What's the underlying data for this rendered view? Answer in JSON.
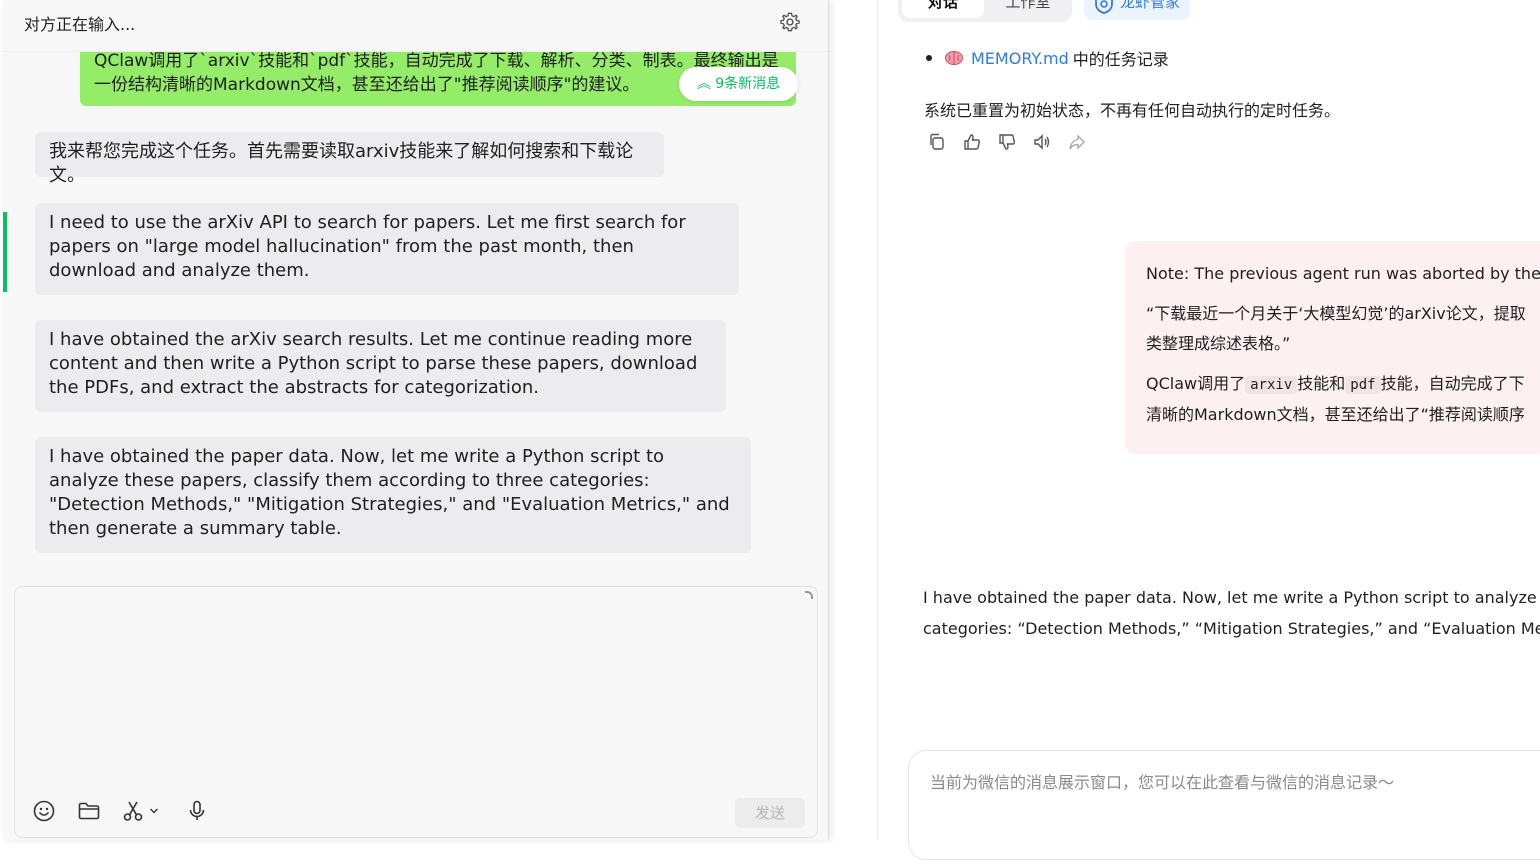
{
  "background": {
    "tabs": [
      {
        "label": "对话",
        "active": true
      },
      {
        "label": "工作室",
        "active": false
      }
    ],
    "guard_label": "龙虾管家",
    "memory_link": "MEMORY.md",
    "memory_suffix": "中的任务记录",
    "reset_text": "系统已重置为初始状态，不再有任何自动执行的定时任务。",
    "user_note": {
      "line1": "Note: The previous agent run was aborted by the us",
      "line2a": "“下载最近一个月关于‘大模型幻觉’的arXiv论文，提取",
      "line2b": "类整理成综述表格。”",
      "line3_prefix": "QClaw调用了",
      "code1": "arxiv",
      "line3_mid": "技能和",
      "code2": "pdf",
      "line3_suffix": "技能，自动完成了下",
      "line4": "清晰的Markdown文档，甚至还给出了“推荐阅读顺序"
    },
    "assistant_para_line1": "I have obtained the paper data. Now, let me write a Python script to analyze these",
    "assistant_para_line2": "categories: “Detection Methods,” “Mitigation Strategies,” and “Evaluation Metrics",
    "input_placeholder": "当前为微信的消息展示窗口，您可以在此查看与微信的消息记录～",
    "link_color": "#2f7ae5"
  },
  "chat": {
    "title": "对方正在输入...",
    "new_messages": "9条新消息",
    "accent_color": "#07c160",
    "messages": [
      {
        "side": "right",
        "text": "QClaw调用了`arxiv`技能和`pdf`技能，自动完成了下载、解析、分类、制表。最终输出是一份结构清晰的Markdown文档，甚至还给出了\"推荐阅读顺序\"的建议。"
      },
      {
        "side": "left",
        "text": "我来帮您完成这个任务。首先需要读取arxiv技能来了解如何搜索和下载论文。"
      },
      {
        "side": "left",
        "text": "I need to use the arXiv API to search for papers. Let me first search for papers on \"large model hallucination\" from the past month, then download and analyze them."
      },
      {
        "side": "left",
        "text": "I have obtained the arXiv search results. Let me continue reading more content and then write a Python script to parse these papers, download the PDFs, and extract the abstracts for categorization."
      },
      {
        "side": "left",
        "text": "I have obtained the paper data. Now, let me write a Python script to analyze these papers, classify them according to three categories: \"Detection Methods,\" \"Mitigation Strategies,\" and \"Evaluation Metrics,\" and then generate a summary table."
      }
    ],
    "composer": {
      "value": "",
      "send_label": "发送",
      "tools": [
        "emoji-icon",
        "folder-icon",
        "scissors-icon",
        "microphone-icon"
      ]
    }
  }
}
